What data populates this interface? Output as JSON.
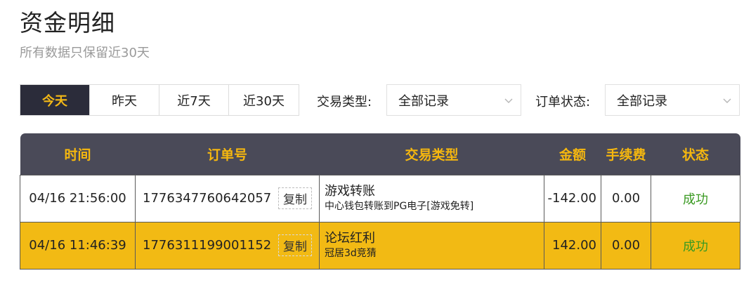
{
  "page": {
    "title": "资金明细",
    "subtitle": "所有数据只保留近30天"
  },
  "tabs": [
    {
      "label": "今天",
      "active": true
    },
    {
      "label": "昨天",
      "active": false
    },
    {
      "label": "近7天",
      "active": false
    },
    {
      "label": "近30天",
      "active": false
    }
  ],
  "filters": {
    "trade_type_label": "交易类型:",
    "trade_type_value": "全部记录",
    "order_status_label": "订单状态:",
    "order_status_value": "全部记录"
  },
  "table": {
    "headers": [
      "时间",
      "订单号",
      "交易类型",
      "金额",
      "手续费",
      "状态"
    ],
    "copy_label": "复制",
    "rows": [
      {
        "time": "04/16 21:56:00",
        "order_no": "1776347760642057",
        "type_main": "游戏转账",
        "type_sub": "中心钱包转账到PG电子[游戏免转]",
        "amount": "-142.00",
        "fee": "0.00",
        "status": "成功"
      },
      {
        "time": "04/16 11:46:39",
        "order_no": "1776311199001152",
        "type_main": "论坛红利",
        "type_sub": "冠居3d竞猜",
        "amount": "142.00",
        "fee": "0.00",
        "status": "成功"
      }
    ]
  },
  "colors": {
    "accent": "#f3b816",
    "header_bg": "#4a4a58",
    "active_tab_bg": "#2b2c3a",
    "success": "#3a9a22"
  }
}
